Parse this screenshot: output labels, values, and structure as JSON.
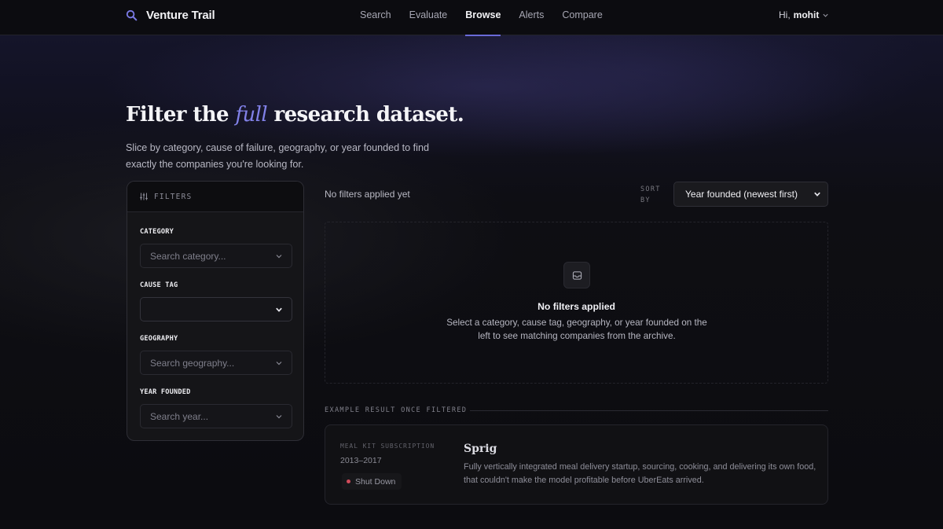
{
  "app": {
    "name": "Venture Trail",
    "accent_color": "#6a6ad8",
    "brand_icon": "search-magnifier-icon"
  },
  "nav": {
    "items": [
      {
        "label": "Search",
        "active": false
      },
      {
        "label": "Evaluate",
        "active": false
      },
      {
        "label": "Browse",
        "active": true
      },
      {
        "label": "Alerts",
        "active": false
      },
      {
        "label": "Compare",
        "active": false
      }
    ]
  },
  "user": {
    "greeting": "Hi,",
    "name": "mohit"
  },
  "hero": {
    "title_before": "Filter the",
    "title_emphasis": "full",
    "title_after": "research dataset.",
    "subtitle": "Slice by category, cause of failure, geography, or year founded to find exactly the companies you're looking for."
  },
  "filters": {
    "heading": "FILTERS",
    "category": {
      "label": "CATEGORY",
      "placeholder": "Search category..."
    },
    "cause_tag": {
      "label": "CAUSE TAG",
      "value": ""
    },
    "geography": {
      "label": "GEOGRAPHY",
      "placeholder": "Search geography..."
    },
    "year_founded": {
      "label": "YEAR FOUNDED",
      "placeholder": "Search year..."
    }
  },
  "results": {
    "status": "No filters applied yet",
    "sort_label": "SORT BY",
    "sort_value": "Year founded (newest first)",
    "empty_icon": "inbox-icon",
    "empty_title": "No filters applied",
    "empty_description": "Select a category, cause tag, geography, or year founded on the left to see matching companies from the archive."
  },
  "example": {
    "label": "EXAMPLE RESULT ONCE FILTERED",
    "category": "MEAL KIT SUBSCRIPTION",
    "years": "2013–2017",
    "status": "Shut Down",
    "status_color": "#d14b5a",
    "name": "Sprig",
    "description": "Fully vertically integrated meal delivery startup, sourcing, cooking, and delivering its own food, that couldn't make the model profitable before UberEats arrived."
  }
}
